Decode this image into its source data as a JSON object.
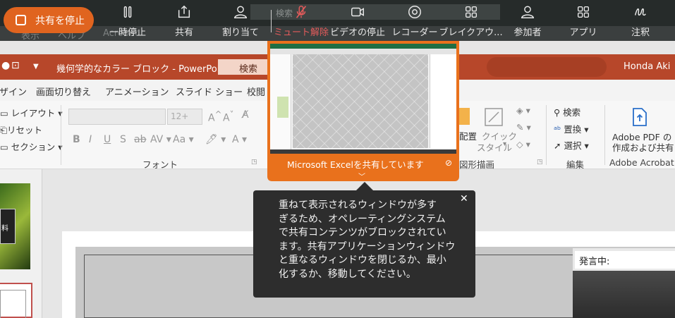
{
  "zoom_toolbar": {
    "stop_share_label": "共有を停止",
    "search_placeholder": "検索",
    "under_menu": [
      "表示",
      "ヘルプ",
      "Acrobat"
    ],
    "buttons": [
      {
        "label": "一時停止",
        "icon": "pause-icon"
      },
      {
        "label": "共有",
        "icon": "share-upload-icon"
      },
      {
        "label": "割り当て",
        "icon": "person-assign-icon"
      },
      {
        "label": "ミュート解除",
        "icon": "mic-muted-icon"
      },
      {
        "label": "ビデオの停止",
        "icon": "video-camera-icon"
      },
      {
        "label": "レコーダー",
        "icon": "record-icon"
      },
      {
        "label": "ブレイクアウ...",
        "icon": "breakout-rooms-icon"
      },
      {
        "label": "参加者",
        "icon": "participants-icon"
      },
      {
        "label": "アプリ",
        "icon": "apps-grid-icon"
      },
      {
        "label": "注釈",
        "icon": "annotate-icon"
      }
    ]
  },
  "powerpoint": {
    "document_title": "幾何学的なカラー ブロック  -  PowerPoint",
    "search_label": "検索",
    "user_name": "Honda Aki",
    "tabs": [
      "ザイン",
      "画面切り替え",
      "アニメーション",
      "スライド ショー",
      "校閲"
    ],
    "ribbon": {
      "slides_group": {
        "layout": "レイアウト",
        "reset": "リセット",
        "section": "セクション"
      },
      "font_group": {
        "label": "フォント",
        "size_value": "12+"
      },
      "drawing_group": {
        "arrange": "配置",
        "quick_style_line1": "クイック",
        "quick_style_line2": "スタイル",
        "label": "図形描画"
      },
      "editing_group": {
        "find": "検索",
        "replace": "置換",
        "select": "選択",
        "label": "編集"
      },
      "acrobat_group": {
        "line1": "Adobe PDF の",
        "line2": "作成および共有",
        "label": "Adobe Acrobat"
      }
    },
    "thumbnail_label": "料",
    "speaker_label": "発言中:"
  },
  "share_overlay": {
    "sharing_text": "Microsoft Excelを共有しています",
    "tooltip_lines": [
      "重ねて表示されるウィンドウが多す",
      "ぎるため、オペレーティングシステム",
      "で共有コンテンツがブロックされてい",
      "ます。共有アプリケーションウィンドウ",
      "と重なるウィンドウを閉じるか、最小",
      "化するか、移動してください。"
    ],
    "close_glyph": "✕"
  },
  "colors": {
    "zoom_bar": "#262b2a",
    "share_orange": "#e9711c",
    "ppt_red": "#b7472a",
    "muted_red": "#e35b5b"
  }
}
